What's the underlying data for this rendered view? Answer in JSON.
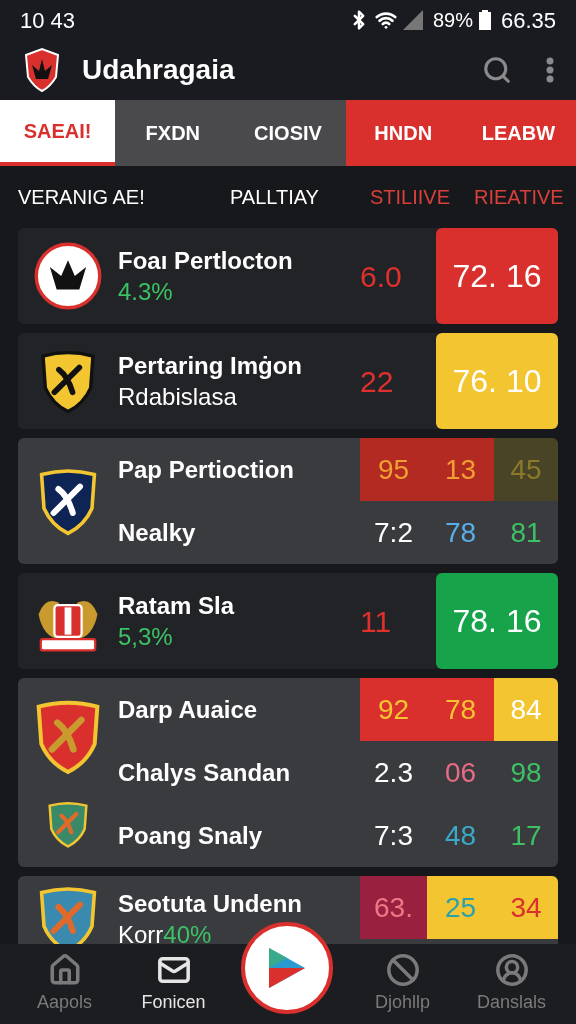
{
  "status_bar": {
    "time": "10 43",
    "battery": "89%",
    "extra": "66.35"
  },
  "app_bar": {
    "title": "Udahragaia"
  },
  "tabs": [
    {
      "label": "SAEAI!",
      "selected": true,
      "color": "#ffffff"
    },
    {
      "label": "FXDN",
      "selected": false,
      "color": "#4a4a4d"
    },
    {
      "label": "CIOSIV",
      "selected": false,
      "color": "#4a4a4d"
    },
    {
      "label": "HNDN",
      "selected": false,
      "color": "#d9302e"
    },
    {
      "label": "LEABW",
      "selected": false,
      "color": "#d9302e"
    }
  ],
  "column_headers": [
    {
      "label": "VERANIG AE!",
      "color": "#ffffff"
    },
    {
      "label": "PALLTIAY",
      "color": "#ffffff"
    },
    {
      "label": "STILIIVE",
      "color": "#d9403a"
    },
    {
      "label": "RIEATIVE",
      "color": "#d9403a"
    }
  ],
  "cards": [
    {
      "kind": "single",
      "name": "Foaı Pertlocton",
      "sub": [
        {
          "text": "4.3%",
          "color": "#3cc164"
        }
      ],
      "score": {
        "text": "6.0",
        "color": "#e0302c"
      },
      "badge": {
        "text": "72. 16",
        "color": "#d9302e"
      }
    },
    {
      "kind": "single",
      "name": "Pertaring Imġon",
      "sub": [
        {
          "text": "Rdabislasa",
          "color": "#ffffff"
        }
      ],
      "score": {
        "text": "22",
        "color": "#e0302c"
      },
      "badge": {
        "text": "76. 10",
        "color": "#f2c531"
      }
    },
    {
      "kind": "grid",
      "rows": [
        {
          "name": "Pap Pertioction",
          "cells": [
            {
              "text": "95",
              "color": "#f0a030",
              "kind": "darkred"
            },
            {
              "text": "13",
              "color": "#f0a030",
              "kind": "darkred"
            },
            {
              "text": "45",
              "color": "#8a7a2a",
              "kind": "olive"
            }
          ]
        },
        {
          "name": "Nealky",
          "cells": [
            {
              "text": "7:2",
              "color": "#ffffff",
              "kind": "plain"
            },
            {
              "text": "78",
              "color": "#5aaee8",
              "kind": "plain"
            },
            {
              "text": "81",
              "color": "#3cc164",
              "kind": "plain"
            }
          ]
        }
      ]
    },
    {
      "kind": "single",
      "name": "Ratam Sla",
      "sub": [
        {
          "text": "5,3%",
          "color": "#3cc164"
        }
      ],
      "score": {
        "text": "11",
        "color": "#e0302c"
      },
      "badge": {
        "text": "78. 16",
        "color": "#17a34a"
      }
    },
    {
      "kind": "grid",
      "rows": [
        {
          "name": "Darp Auaice",
          "cells": [
            {
              "text": "92",
              "color": "#f5c531",
              "kind": "red"
            },
            {
              "text": "78",
              "color": "#f5c531",
              "kind": "red"
            },
            {
              "text": "84",
              "color": "#ffffff",
              "kind": "yellow"
            }
          ]
        },
        {
          "name": "Chalys Sandan",
          "cells": [
            {
              "text": "2.3",
              "color": "#ffffff",
              "kind": "plain"
            },
            {
              "text": "06",
              "color": "#e86b86",
              "kind": "plain"
            },
            {
              "text": "98",
              "color": "#3cc164",
              "kind": "plain"
            }
          ]
        },
        {
          "name": "Poang Snaly",
          "cells": [
            {
              "text": "7:3",
              "color": "#ffffff",
              "kind": "plain"
            },
            {
              "text": "48",
              "color": "#3aaac8",
              "kind": "plain"
            },
            {
              "text": "17",
              "color": "#3cc164",
              "kind": "plain"
            }
          ]
        }
      ]
    },
    {
      "kind": "grid",
      "rows": [
        {
          "name": "Seotuta Undenn",
          "sub": [
            {
              "text": "Korr",
              "color": "#ffffff"
            },
            {
              "text": "40%",
              "color": "#3cc164"
            }
          ],
          "cells": [
            {
              "text": "63.",
              "color": "#e87a86",
              "kind": "maroon"
            },
            {
              "text": "25",
              "color": "#2aa0b0",
              "kind": "yellow"
            },
            {
              "text": "34",
              "color": "#d9302e",
              "kind": "yellow"
            }
          ]
        }
      ]
    }
  ],
  "bottom_nav": [
    {
      "label": "Aapols",
      "selected": false
    },
    {
      "label": "Fonicen",
      "selected": true
    },
    {
      "label": "Djohllp",
      "selected": false
    },
    {
      "label": "Danslals",
      "selected": false
    }
  ]
}
